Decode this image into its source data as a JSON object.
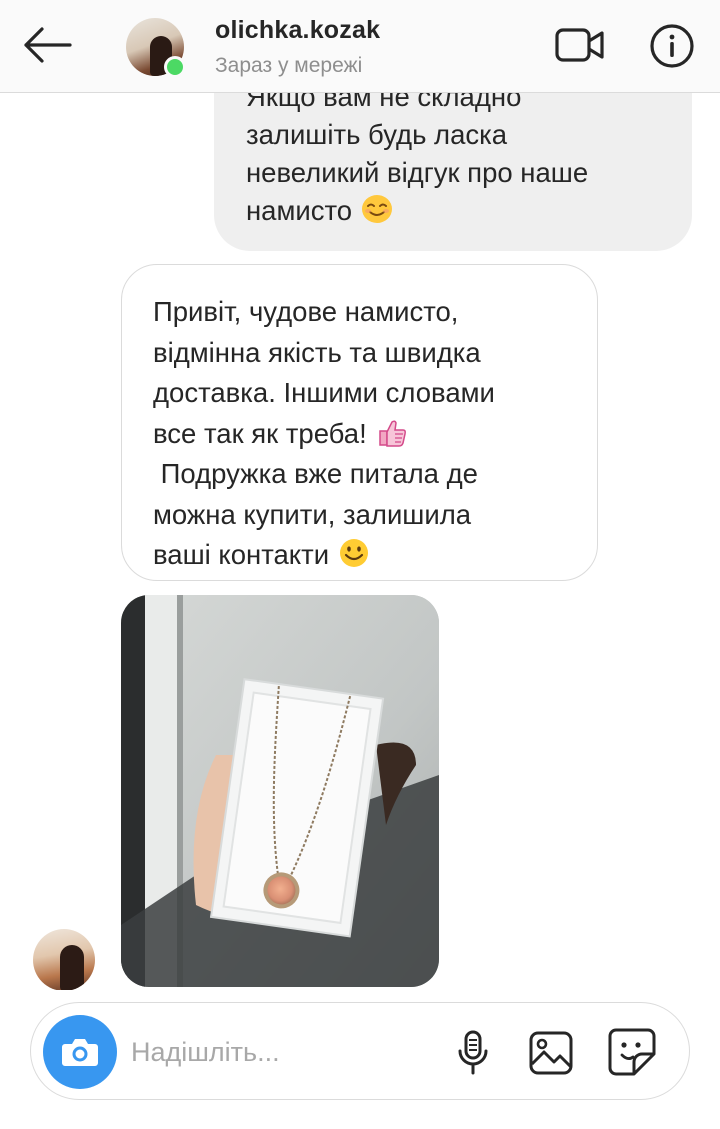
{
  "header": {
    "username": "olichka.kozak",
    "status": "Зараз у мережі",
    "icons": {
      "back": "arrow-left-icon",
      "video": "video-camera-icon",
      "info": "info-icon"
    },
    "online_color": "#4cd964"
  },
  "messages": {
    "outgoing": {
      "text": "Якщо вам не складно\nзалишіть будь ласка\nневеликий відгук про наше\nнамисто",
      "emoji": "smiling-face-icon"
    },
    "incoming": {
      "text_part1": "Привіт, чудове намисто,\nвідмінна якість та швидка\nдоставка. Іншими словами\nвсе так як треба!",
      "emoji1": "thumbs-up-icon",
      "text_part2": " Подружка вже питала де\nможна купити, залишила\nваші контакти",
      "emoji2": "smiling-face-icon"
    },
    "photo": {
      "subject": "necklace-in-box-photo"
    }
  },
  "composer": {
    "placeholder": "Надішліть...",
    "accent_color": "#3897f0",
    "icons": {
      "camera": "camera-icon",
      "mic": "microphone-icon",
      "gallery": "gallery-icon",
      "sticker": "sticker-icon"
    }
  }
}
